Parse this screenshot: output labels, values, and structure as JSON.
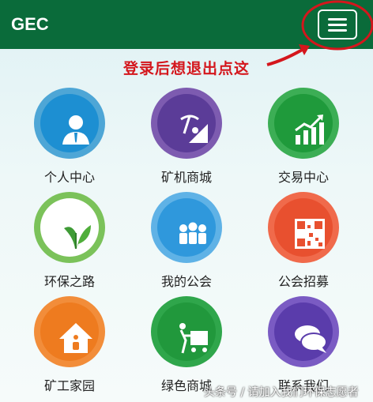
{
  "header": {
    "brand": "GEC"
  },
  "annotation": {
    "text": "登录后想退出点这"
  },
  "tiles": [
    {
      "label": "个人中心",
      "icon": "person-icon",
      "ring": "#4ea6d6",
      "fill": "#1d8fd2"
    },
    {
      "label": "矿机商城",
      "icon": "mining-icon",
      "ring": "#7d5bb0",
      "fill": "#5b3c98"
    },
    {
      "label": "交易中心",
      "icon": "chart-icon",
      "ring": "#3cae55",
      "fill": "#1f9a3b"
    },
    {
      "label": "环保之路",
      "icon": "leaf-icon",
      "ring": "#7bc25a",
      "fill": "#ffffff"
    },
    {
      "label": "我的公会",
      "icon": "group-icon",
      "ring": "#5fb2e6",
      "fill": "#2f98dc"
    },
    {
      "label": "公会招募",
      "icon": "qrcode-icon",
      "ring": "#f06a4b",
      "fill": "#e8502f"
    },
    {
      "label": "矿工家园",
      "icon": "home-icon",
      "ring": "#f28d3a",
      "fill": "#ee7b1f"
    },
    {
      "label": "绿色商城",
      "icon": "cart-icon",
      "ring": "#2fa64b",
      "fill": "#21983c"
    },
    {
      "label": "联系我们",
      "icon": "chat-icon",
      "ring": "#7a5bc3",
      "fill": "#5a3cab"
    }
  ],
  "watermark": "头条号 / 请加入我们环保志愿者"
}
